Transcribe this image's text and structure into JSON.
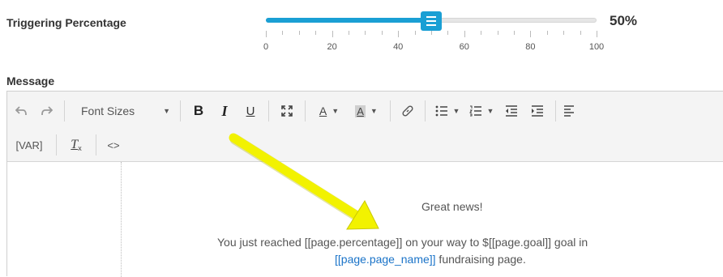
{
  "trigger": {
    "label": "Triggering Percentage",
    "value": 50,
    "value_text": "50%",
    "min": 0,
    "max": 100,
    "tick_labels": [
      "0",
      "20",
      "40",
      "60",
      "80",
      "100"
    ],
    "accent_color": "#1a9fd4"
  },
  "message": {
    "label": "Message",
    "toolbar": {
      "undo_icon": "undo-icon",
      "redo_icon": "redo-icon",
      "font_sizes_label": "Font Sizes",
      "bold_label": "B",
      "italic_label": "I",
      "underline_label": "U",
      "fullscreen_icon": "fullscreen-icon",
      "text_color_label": "A",
      "bg_color_label": "A",
      "link_icon": "link-icon",
      "bullet_list_icon": "bullet-list-icon",
      "numbered_list_icon": "numbered-list-icon",
      "outdent_icon": "outdent-icon",
      "indent_icon": "indent-icon",
      "align_left_icon": "align-left-icon",
      "var_label": "[VAR]",
      "clear_format_label": "T",
      "code_label": "<>"
    },
    "body": {
      "line1": "Great news!",
      "line2_prefix": "You just reached ",
      "line2_var1": "[[page.percentage]]",
      "line2_mid": " on your way to $",
      "line2_var2": "[[page.goal]]",
      "line2_suffix": " goal in",
      "line3_var": "[[page.page_name]]",
      "line3_suffix": " fundraising page."
    },
    "variable_color": "#1a73c8"
  },
  "annotation": {
    "arrow_color": "#f2f200"
  }
}
